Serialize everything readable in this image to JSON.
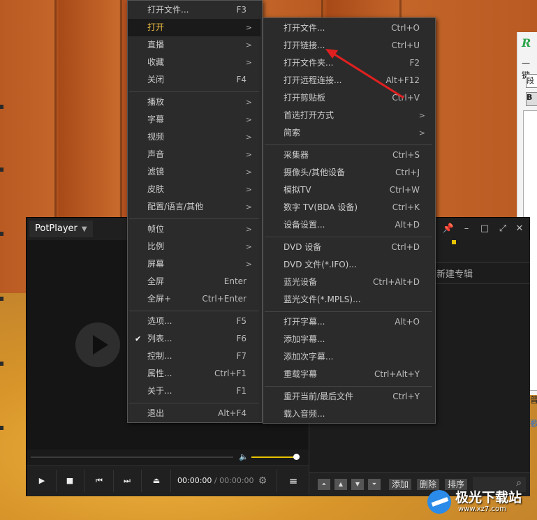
{
  "background_window": {
    "logo_letter": "R",
    "text_1": "一键",
    "box_1": "段",
    "box_2": "B",
    "frag_1": "普",
    "frag_2": "歌"
  },
  "player": {
    "brand": "PotPlayer",
    "time_current": "00:00:00",
    "time_separator": "/",
    "time_total": "00:00:00",
    "playlist": {
      "album_label": "新建专辑",
      "add_button": "添加",
      "delete_button": "删除",
      "sort_button": "排序"
    }
  },
  "context_menu": {
    "items": [
      {
        "label": "打开文件...",
        "shortcut": "F3"
      },
      {
        "label": "打开",
        "submenu": true,
        "highlighted": true
      },
      {
        "label": "直播",
        "submenu": true
      },
      {
        "label": "收藏",
        "submenu": true
      },
      {
        "label": "关闭",
        "shortcut": "F4"
      },
      {
        "label": "播放",
        "submenu": true
      },
      {
        "label": "字幕",
        "submenu": true
      },
      {
        "label": "视频",
        "submenu": true
      },
      {
        "label": "声音",
        "submenu": true
      },
      {
        "label": "滤镜",
        "submenu": true
      },
      {
        "label": "皮肤",
        "submenu": true
      },
      {
        "label": "配置/语言/其他",
        "submenu": true
      },
      {
        "label": "帧位",
        "submenu": true
      },
      {
        "label": "比例",
        "submenu": true
      },
      {
        "label": "屏幕",
        "submenu": true
      },
      {
        "label": "全屏",
        "shortcut": "Enter"
      },
      {
        "label": "全屏+",
        "shortcut": "Ctrl+Enter"
      },
      {
        "label": "选项...",
        "shortcut": "F5"
      },
      {
        "label": "列表...",
        "shortcut": "F6",
        "checked": true
      },
      {
        "label": "控制...",
        "shortcut": "F7"
      },
      {
        "label": "属性...",
        "shortcut": "Ctrl+F1"
      },
      {
        "label": "关于...",
        "shortcut": "F1"
      },
      {
        "label": "退出",
        "shortcut": "Alt+F4"
      }
    ]
  },
  "open_submenu": {
    "items": [
      {
        "label": "打开文件...",
        "shortcut": "Ctrl+O"
      },
      {
        "label": "打开链接...",
        "shortcut": "Ctrl+U"
      },
      {
        "label": "打开文件夹...",
        "shortcut": "F2"
      },
      {
        "label": "打开远程连接...",
        "shortcut": "Alt+F12"
      },
      {
        "label": "打开剪贴板",
        "shortcut": "Ctrl+V"
      },
      {
        "label": "首选打开方式",
        "submenu": true
      },
      {
        "label": "简索",
        "submenu": true
      },
      {
        "label": "采集器",
        "shortcut": "Ctrl+S"
      },
      {
        "label": "摄像头/其他设备",
        "shortcut": "Ctrl+J"
      },
      {
        "label": "模拟TV",
        "shortcut": "Ctrl+W"
      },
      {
        "label": "数字 TV(BDA 设备)",
        "shortcut": "Ctrl+K"
      },
      {
        "label": "设备设置...",
        "shortcut": "Alt+D"
      },
      {
        "label": "DVD 设备",
        "shortcut": "Ctrl+D"
      },
      {
        "label": "DVD 文件(*.IFO)...",
        "shortcut": ""
      },
      {
        "label": "蓝光设备",
        "shortcut": "Ctrl+Alt+D"
      },
      {
        "label": "蓝光文件(*.MPLS)...",
        "shortcut": ""
      },
      {
        "label": "打开字幕...",
        "shortcut": "Alt+O"
      },
      {
        "label": "添加字幕...",
        "shortcut": ""
      },
      {
        "label": "添加次字幕...",
        "shortcut": ""
      },
      {
        "label": "重载字幕",
        "shortcut": "Ctrl+Alt+Y"
      },
      {
        "label": "重开当前/最后文件",
        "shortcut": "Ctrl+Y"
      },
      {
        "label": "载入音频...",
        "shortcut": ""
      }
    ]
  },
  "watermark": {
    "title": "极光下载站",
    "url": "www.xz7.com"
  },
  "colors": {
    "menu_bg": "#2b2b2b",
    "highlight_text": "#f0c040",
    "annotation_arrow": "#e02020",
    "volume_accent": "#e8c400"
  },
  "icons": {
    "submenu_arrow": ">",
    "checkmark": "✔"
  }
}
